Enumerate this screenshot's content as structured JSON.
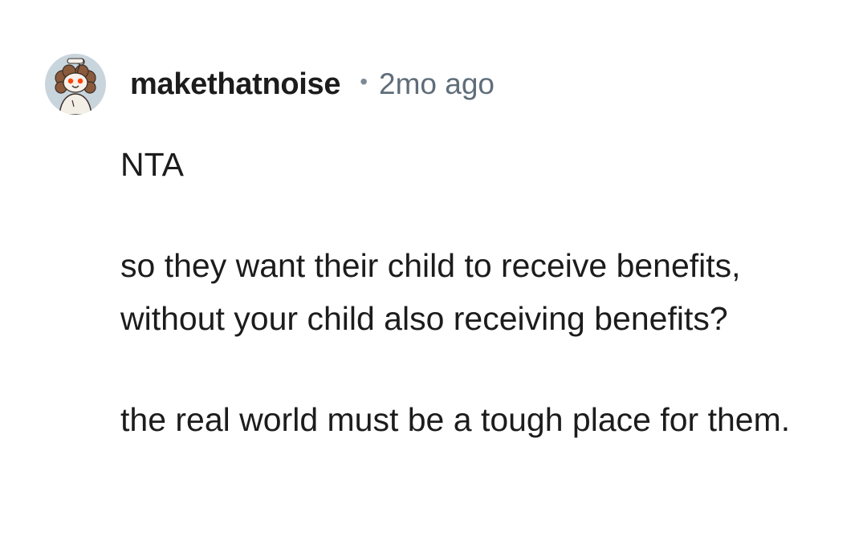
{
  "comment": {
    "author": "makethatnoise",
    "separator": "•",
    "timestamp": "2mo ago",
    "avatar_icon": "snoo-avatar-icon",
    "paragraphs": [
      "NTA",
      "so they want their child to receive benefits, without your child also receiving benefits?",
      "the real world must be a tough place for them."
    ]
  }
}
